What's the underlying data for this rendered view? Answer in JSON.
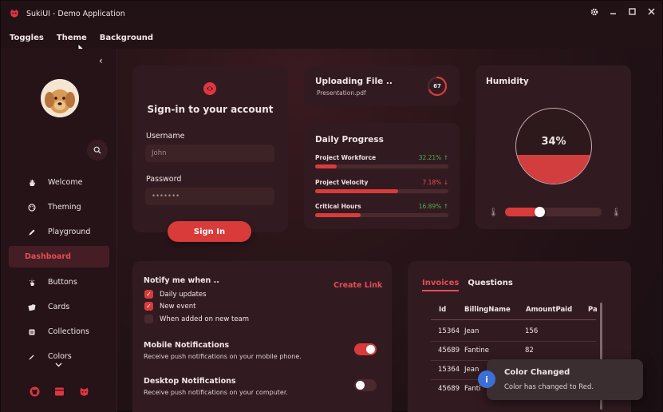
{
  "window": {
    "title": "SukiUI - Demo Application",
    "icons": [
      "settings-icon",
      "minimize-icon",
      "maximize-icon",
      "close-icon"
    ]
  },
  "menu": {
    "items": [
      "Toggles",
      "Theme",
      "Background"
    ]
  },
  "sidebar": {
    "items": [
      {
        "label": "Welcome",
        "icon": "hand-icon"
      },
      {
        "label": "Theming",
        "icon": "palette-icon"
      },
      {
        "label": "Playground",
        "icon": "pencil-icon"
      },
      {
        "label": "Dashboard",
        "icon": "",
        "active": true
      },
      {
        "label": "Buttons",
        "icon": "pointer-icon"
      },
      {
        "label": "Cards",
        "icon": "cards-icon"
      },
      {
        "label": "Collections",
        "icon": "list-icon"
      },
      {
        "label": "Colors",
        "icon": "eyedropper-icon"
      }
    ],
    "footer_icons": [
      "github-icon",
      "window-icon",
      "cat-icon"
    ]
  },
  "login": {
    "heading": "Sign-in to your account",
    "username_label": "Username",
    "username_value": "John",
    "password_label": "Password",
    "password_value": "•••••••",
    "button": "Sign In"
  },
  "upload": {
    "title": "Uploading File ..",
    "file": "Presentation.pdf",
    "percent": "67",
    "fraction": 0.67
  },
  "progress": {
    "title": "Daily Progress",
    "rows": [
      {
        "label": "Project Workforce",
        "value": "32.21%",
        "trend": "up",
        "fill": 0.16,
        "color": "#4caf50"
      },
      {
        "label": "Project Velocity",
        "value": "7.18%",
        "trend": "down",
        "fill": 0.62,
        "color": "#e44d56"
      },
      {
        "label": "Critical Hours",
        "value": "16.89%",
        "trend": "up",
        "fill": 0.34,
        "color": "#4caf50"
      }
    ]
  },
  "humidity": {
    "title": "Humidity",
    "value": "34%",
    "level": 0.34,
    "slider": 0.34
  },
  "notify": {
    "heading": "Notify me when ..",
    "link": "Create Link",
    "checks": [
      {
        "label": "Daily updates",
        "checked": true
      },
      {
        "label": "New event",
        "checked": true
      },
      {
        "label": "When added on new team",
        "checked": false
      }
    ],
    "rows": [
      {
        "title": "Mobile Notifications",
        "desc": "Receive push notifications on your mobile phone.",
        "on": true
      },
      {
        "title": "Desktop Notifications",
        "desc": "Receive push notifications on your computer.",
        "on": false
      }
    ]
  },
  "table": {
    "tabs": [
      "Invoices",
      "Questions"
    ],
    "headers": [
      "Id",
      "BillingName",
      "AmountPaid",
      "Pa"
    ],
    "rows": [
      [
        "15364",
        "Jean",
        "156"
      ],
      [
        "45689",
        "Fantine",
        "82"
      ],
      [
        "15364",
        "Jean",
        ""
      ],
      [
        "45689",
        "Fanti",
        ""
      ]
    ]
  },
  "toast": {
    "title": "Color Changed",
    "message": "Color has changed to Red.",
    "icon": "i"
  },
  "colors": {
    "accent": "#d93b3b",
    "positive": "#4caf50",
    "negative": "#e44d56"
  }
}
